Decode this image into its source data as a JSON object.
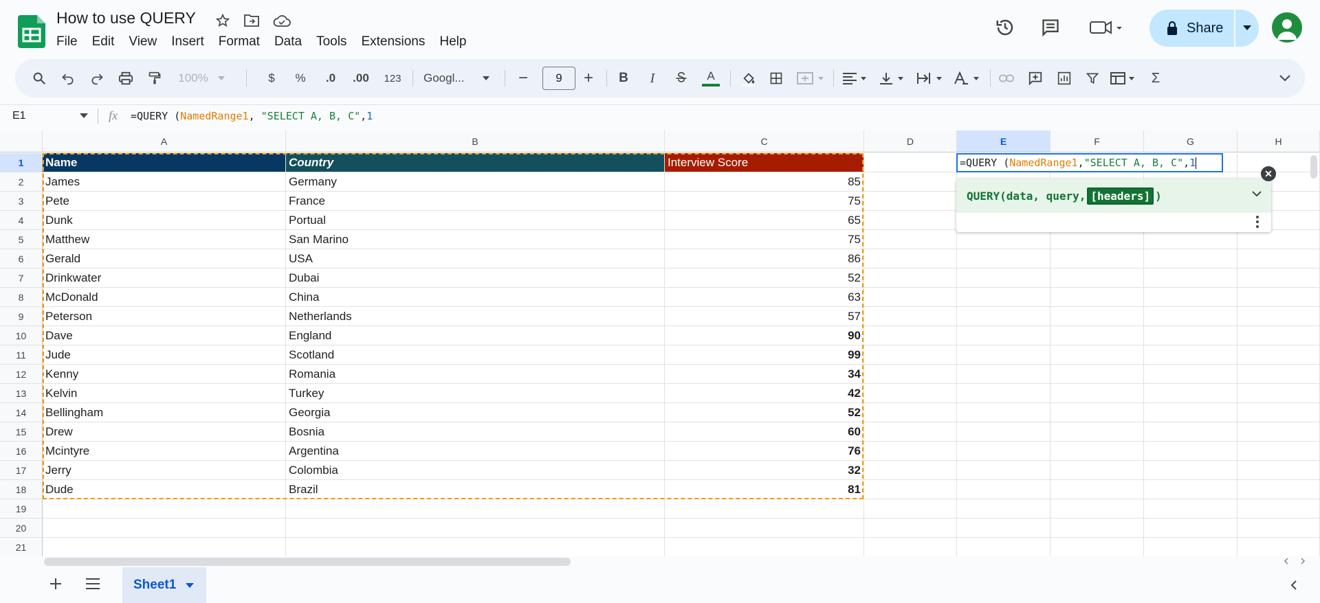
{
  "doc": {
    "title": "How to use QUERY",
    "menu": [
      "File",
      "Edit",
      "View",
      "Insert",
      "Format",
      "Data",
      "Tools",
      "Extensions",
      "Help"
    ]
  },
  "topbar": {
    "share_label": "Share"
  },
  "toolbar": {
    "zoom": "100%",
    "currency": "$",
    "percent": "%",
    "dec_decrease": ".0",
    "dec_increase": ".00",
    "more_formats": "123",
    "font": "Googl...",
    "font_size": "9",
    "bold": "B",
    "italic": "I",
    "text_color_label": "A",
    "sum": "Σ"
  },
  "formula_bar": {
    "name_box": "E1",
    "fx": "fx",
    "formula_prefix": "=QUERY (",
    "formula_range": "NamedRange1",
    "formula_sep": ", ",
    "formula_string": "\"SELECT A, B, C\"",
    "formula_comma": ",",
    "formula_num": "1"
  },
  "grid": {
    "columns": [
      "A",
      "B",
      "C",
      "D",
      "E",
      "F",
      "G",
      "H"
    ],
    "rows": [
      "1",
      "2",
      "3",
      "4",
      "5",
      "6",
      "7",
      "8",
      "9",
      "10",
      "11",
      "12",
      "13",
      "14",
      "15",
      "16",
      "17",
      "18",
      "19",
      "20",
      "21"
    ],
    "header": [
      "Name",
      "Country",
      "Interview Score"
    ],
    "data": [
      [
        "James",
        "Germany",
        "85"
      ],
      [
        "Pete",
        "France",
        "75"
      ],
      [
        "Dunk",
        "Portual",
        "65"
      ],
      [
        "Matthew",
        "San Marino",
        "75"
      ],
      [
        "Gerald",
        "USA",
        "86"
      ],
      [
        "Drinkwater",
        "Dubai",
        "52"
      ],
      [
        "McDonald",
        "China",
        "63"
      ],
      [
        "Peterson",
        "Netherlands",
        "57"
      ],
      [
        "Dave",
        "England",
        "90"
      ],
      [
        "Jude",
        "Scotland",
        "99"
      ],
      [
        "Kenny",
        "Romania",
        "34"
      ],
      [
        "Kelvin",
        "Turkey",
        "42"
      ],
      [
        "Bellingham",
        "Georgia",
        "52"
      ],
      [
        "Drew",
        "Bosnia",
        "60"
      ],
      [
        "Mcintyre",
        "Argentina",
        "76"
      ],
      [
        "Jerry",
        "Colombia",
        "32"
      ],
      [
        "Dude",
        "Brazil",
        "81"
      ]
    ],
    "header_colors": {
      "A": "#073763",
      "B": "#134f5c",
      "C": "#a61c00"
    }
  },
  "fn_popup": {
    "signature_prefix": "QUERY(data, query, ",
    "signature_arg": "[headers]",
    "signature_suffix": ")"
  },
  "sheets": {
    "tab": "Sheet1"
  }
}
